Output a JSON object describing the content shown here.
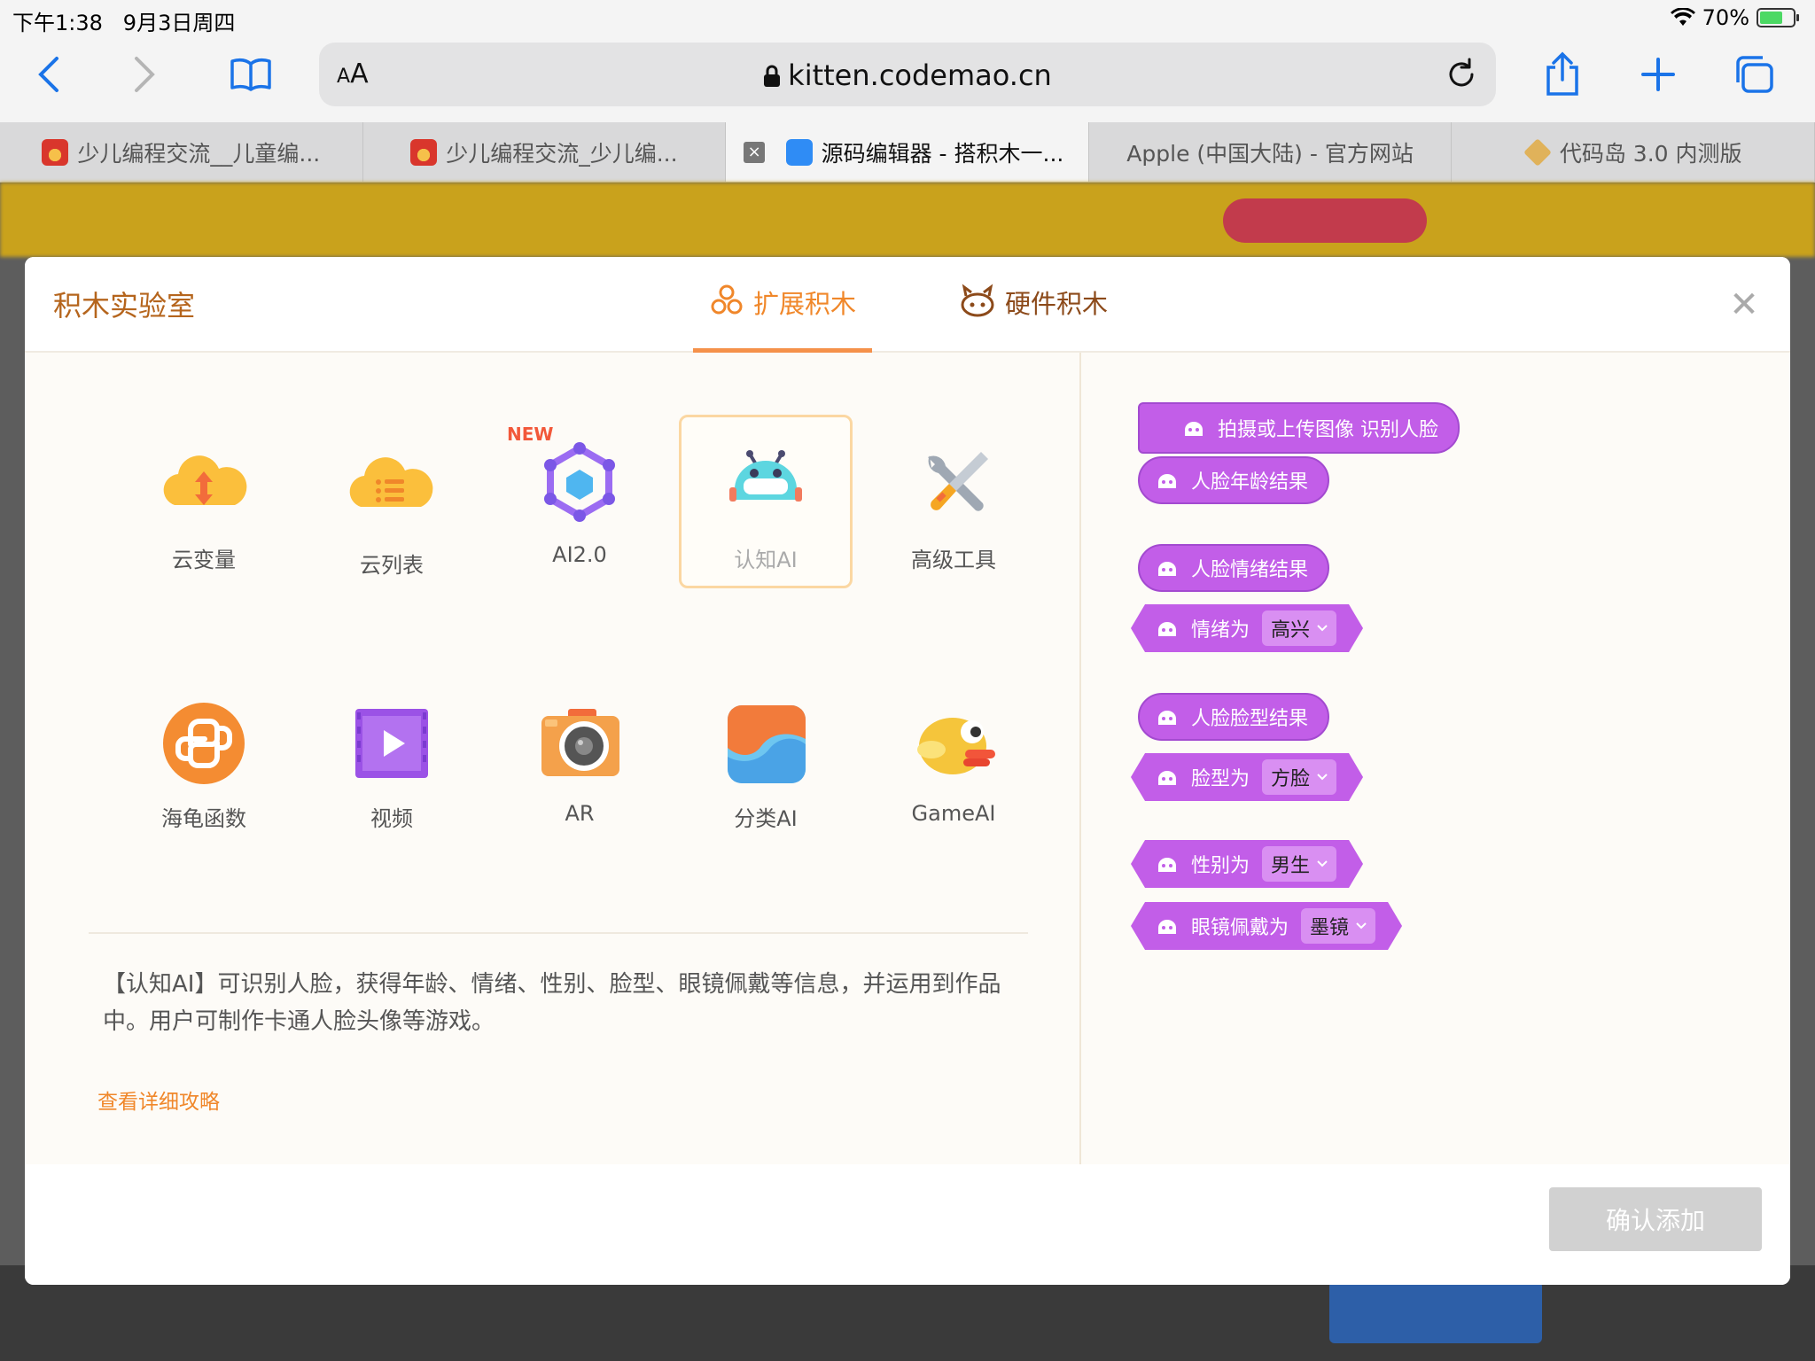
{
  "status": {
    "time": "下午1:38",
    "date": "9月3日周四",
    "battery": "70%",
    "battery_level": 0.7
  },
  "browser": {
    "aa_label_small": "A",
    "aa_label_big": "A",
    "url": "kitten.codemao.cn",
    "tabs": [
      {
        "label": "少儿编程交流__儿童编...",
        "active": false
      },
      {
        "label": "少儿编程交流_少儿编...",
        "active": false
      },
      {
        "label": "源码编辑器 - 搭积木一...",
        "active": true
      },
      {
        "label": "Apple (中国大陆) - 官方网站",
        "active": false
      },
      {
        "label": "代码岛 3.0 内测版",
        "active": false
      }
    ],
    "close_tab_glyph": "×"
  },
  "modal": {
    "title": "积木实验室",
    "tab_extension": "扩展积木",
    "tab_hardware": "硬件积木",
    "close_glyph": "✕",
    "new_badge": "NEW",
    "extensions": [
      {
        "label": "云变量",
        "icon": "cloud-variable-icon"
      },
      {
        "label": "云列表",
        "icon": "cloud-list-icon"
      },
      {
        "label": "AI2.0",
        "icon": "ai2-hexagon-icon"
      },
      {
        "label": "认知AI",
        "icon": "robot-face-icon",
        "selected": true
      },
      {
        "label": "高级工具",
        "icon": "wrench-screwdriver-icon"
      },
      {
        "label": "海龟函数",
        "icon": "python-icon"
      },
      {
        "label": "视频",
        "icon": "video-play-icon"
      },
      {
        "label": "AR",
        "icon": "camera-icon"
      },
      {
        "label": "分类AI",
        "icon": "wave-icon"
      },
      {
        "label": "GameAI",
        "icon": "flappy-bird-icon"
      }
    ],
    "description": "【认知AI】可识别人脸，获得年龄、情绪、性别、脸型、眼镜佩戴等信息，并运用到作品中。用户可制作卡通人脸头像等游戏。",
    "guide_link": "查看详细攻略",
    "blocks": {
      "capture": "拍摄或上传图像 识别人脸",
      "age": "人脸年龄结果",
      "emotion": "人脸情绪结果",
      "emotion_is": "情绪为",
      "emotion_value": "高兴",
      "faceshape": "人脸脸型结果",
      "faceshape_is": "脸型为",
      "faceshape_value": "方脸",
      "gender_is": "性别为",
      "gender_value": "男生",
      "glasses_is": "眼镜佩戴为",
      "glasses_value": "墨镜"
    },
    "confirm": "确认添加"
  },
  "colors": {
    "accent": "#f0872a",
    "block": "#c25ee8",
    "title": "#b5651d"
  }
}
